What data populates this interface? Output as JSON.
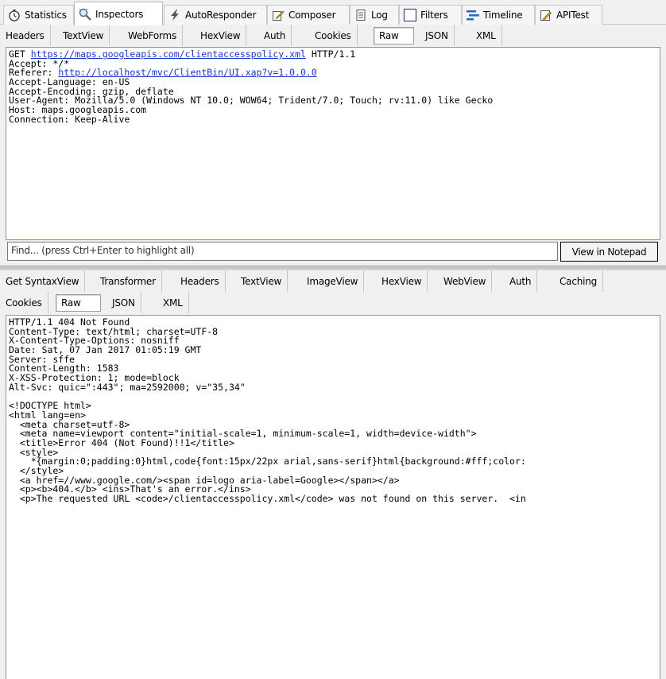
{
  "main_tabs": [
    {
      "label": "Statistics",
      "icon": "stopwatch-icon"
    },
    {
      "label": "Inspectors",
      "icon": "magnifier-icon"
    },
    {
      "label": "AutoResponder",
      "icon": "lightning-icon"
    },
    {
      "label": "Composer",
      "icon": "compose-icon"
    },
    {
      "label": "Log",
      "icon": "log-icon"
    },
    {
      "label": "Filters",
      "icon": "checkbox-icon"
    },
    {
      "label": "Timeline",
      "icon": "timeline-icon"
    },
    {
      "label": "APITest",
      "icon": "pencil-icon"
    }
  ],
  "request_tabs": [
    "Headers",
    "TextView",
    "WebForms",
    "HexView",
    "Auth",
    "Cookies",
    "Raw",
    "JSON",
    "XML"
  ],
  "request": {
    "method": "GET",
    "url": "https://maps.googleapis.com/clientaccesspolicy.xml",
    "protocol": " HTTP/1.1",
    "accept": "Accept: */*",
    "referer_label": "Referer: ",
    "referer_url": "http://localhost/mvc/ClientBin/UI.xap?v=1.0.0.0",
    "lines": [
      "Accept-Language: en-US",
      "Accept-Encoding: gzip, deflate",
      "User-Agent: Mozilla/5.0 (Windows NT 10.0; WOW64; Trident/7.0; Touch; rv:11.0) like Gecko",
      "Host: maps.googleapis.com",
      "Connection: Keep-Alive"
    ]
  },
  "find": {
    "placeholder": "Find... (press Ctrl+Enter to highlight all)",
    "button_label": "View in Notepad"
  },
  "response_tabs_row1": [
    "Get SyntaxView",
    "Transformer",
    "Headers",
    "TextView",
    "ImageView",
    "HexView",
    "WebView",
    "Auth",
    "Caching"
  ],
  "response_tabs_row2": [
    "Cookies",
    "Raw",
    "JSON",
    "XML"
  ],
  "response": {
    "headers": [
      "HTTP/1.1 404 Not Found",
      "Content-Type: text/html; charset=UTF-8",
      "X-Content-Type-Options: nosniff",
      "Date: Sat, 07 Jan 2017 01:05:19 GMT",
      "Server: sffe",
      "Content-Length: 1583",
      "X-XSS-Protection: 1; mode=block",
      "Alt-Svc: quic=\":443\"; ma=2592000; v=\"35,34\""
    ],
    "body": [
      "<!DOCTYPE html>",
      "<html lang=en>",
      "  <meta charset=utf-8>",
      "  <meta name=viewport content=\"initial-scale=1, minimum-scale=1, width=device-width\">",
      "  <title>Error 404 (Not Found)!!1</title>",
      "  <style>",
      "    *{margin:0;padding:0}html,code{font:15px/22px arial,sans-serif}html{background:#fff;color:",
      "  </style>",
      "  <a href=//www.google.com/><span id=logo aria-label=Google></span></a>",
      "  <p><b>404.</b> <ins>That's an error.</ins>",
      "  <p>The requested URL <code>/clientaccesspolicy.xml</code> was not found on this server.  <in"
    ]
  }
}
